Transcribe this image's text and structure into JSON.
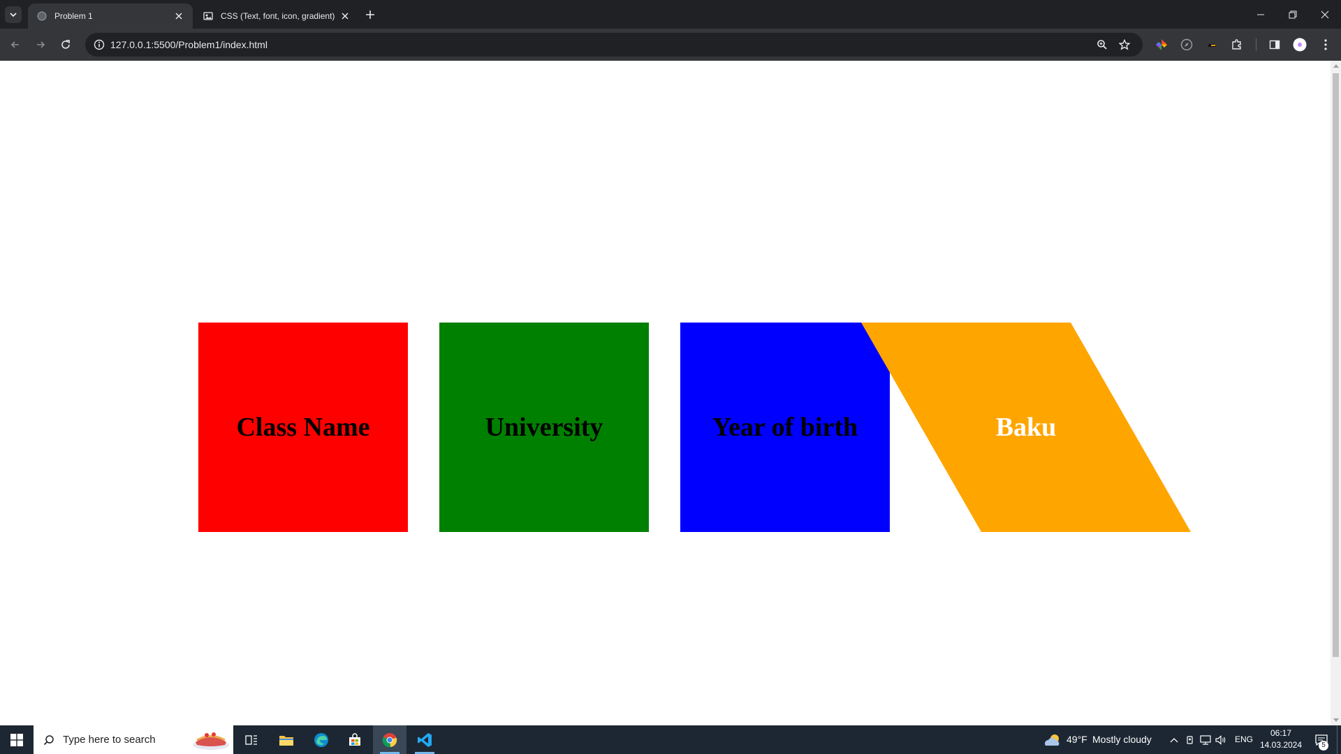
{
  "browser": {
    "tabs": [
      {
        "title": "Problem 1",
        "favicon": "globe-icon",
        "active": true
      },
      {
        "title": "CSS (Text, font, icon, gradient)",
        "favicon": "image-icon",
        "active": false
      }
    ],
    "address": {
      "url": "127.0.0.1:5500/Problem1/index.html"
    }
  },
  "page": {
    "boxes": [
      {
        "label": "Class Name",
        "color": "#ff0000"
      },
      {
        "label": "University",
        "color": "#008000"
      },
      {
        "label": "Year of birth",
        "color": "#0000ff"
      },
      {
        "label": "Baku",
        "color": "#ffa500"
      }
    ]
  },
  "taskbar": {
    "search_placeholder": "Type here to search",
    "weather": {
      "temp": "49°F",
      "condition": "Mostly cloudy"
    },
    "language": "ENG",
    "time": "06:17",
    "date": "14.03.2024",
    "notification_count": "5"
  },
  "colors": {
    "tabstrip_bg": "#202124",
    "toolbar_bg": "#35363a",
    "taskbar_bg": "#1c2733"
  }
}
